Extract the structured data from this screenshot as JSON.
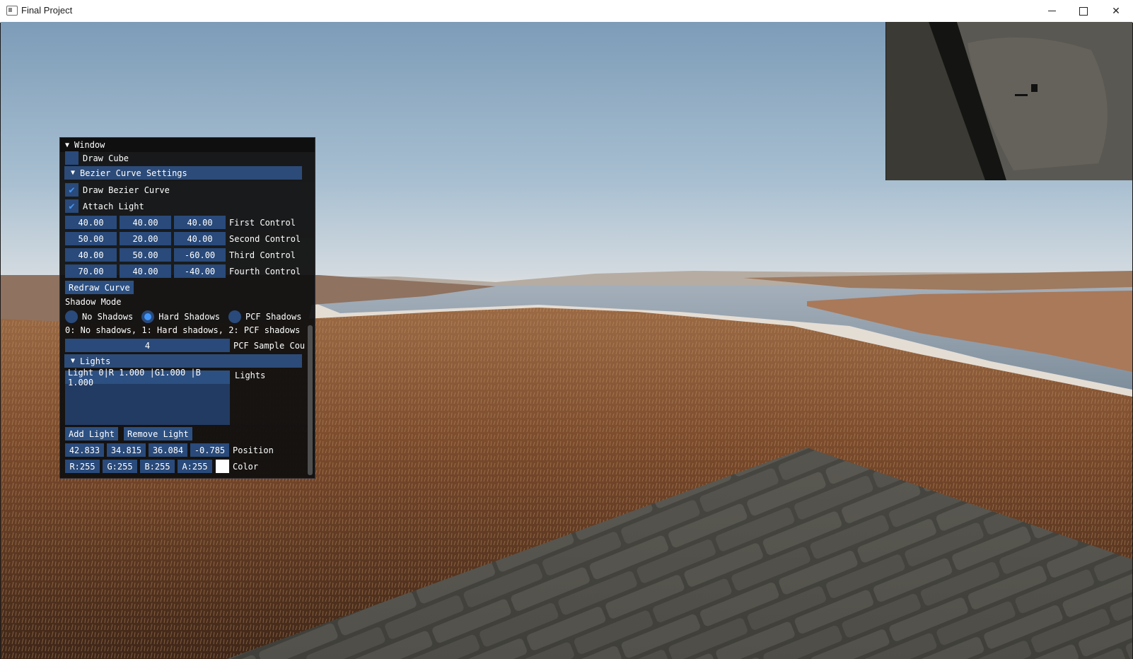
{
  "window": {
    "title": "Final Project",
    "controls": {
      "minimize": "—",
      "maximize": "☐",
      "close": "✕"
    }
  },
  "panel": {
    "title": "Window",
    "draw_cube": {
      "label": "Draw Cube",
      "checked": false
    },
    "bezier_header": "Bezier Curve Settings",
    "draw_bezier": {
      "label": "Draw Bezier Curve",
      "checked": true
    },
    "attach_light": {
      "label": "Attach Light",
      "checked": true
    },
    "controls": [
      {
        "label": "First Control",
        "values": [
          "40.00",
          "40.00",
          "40.00"
        ]
      },
      {
        "label": "Second Control",
        "values": [
          "50.00",
          "20.00",
          "40.00"
        ]
      },
      {
        "label": "Third Control",
        "values": [
          "40.00",
          "50.00",
          "-60.00"
        ]
      },
      {
        "label": "Fourth Control",
        "values": [
          "70.00",
          "40.00",
          "-40.00"
        ]
      }
    ],
    "redraw_button": "Redraw Curve",
    "shadow_mode_label": "Shadow Mode",
    "shadow_options": [
      {
        "label": "No Shadows",
        "selected": false
      },
      {
        "label": "Hard Shadows",
        "selected": true
      },
      {
        "label": "PCF Shadows",
        "selected": false
      }
    ],
    "shadow_help": "0: No shadows, 1: Hard shadows, 2: PCF shadows",
    "pcf_value": "4",
    "pcf_label": "PCF Sample Cou",
    "lights_header": "Lights",
    "lights_list_item": "Light 0|R 1.000 |G1.000 |B 1.000",
    "lights_list_label": "Lights",
    "add_light": "Add Light",
    "remove_light": "Remove Light",
    "position_values": [
      "42.833",
      "34.815",
      "36.084",
      "-0.785"
    ],
    "position_label": "Position",
    "color_values": [
      "R:255",
      "G:255",
      "B:255",
      "A:255"
    ],
    "color_label": "Color",
    "swatch_color": "#ffffff"
  },
  "colors": {
    "accent": "#4296fa",
    "frame_bg": "#294a7a",
    "header": "#2c4b78"
  }
}
